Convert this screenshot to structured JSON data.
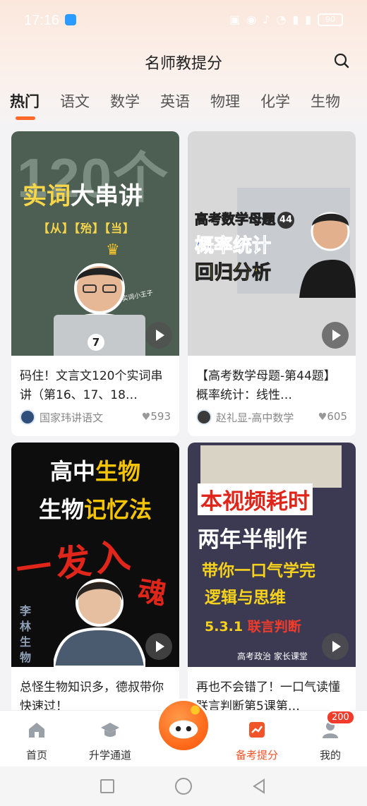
{
  "status": {
    "time": "17:16",
    "battery": "90"
  },
  "header": {
    "title": "名师教提分"
  },
  "tabs": [
    "热门",
    "语文",
    "数学",
    "英语",
    "物理",
    "化学",
    "生物"
  ],
  "cards": [
    {
      "title": "码住！文言文120个实词串讲（第16、17、18…",
      "author": "国家玮讲语文",
      "likes": "593",
      "thumb": {
        "big": "120个",
        "banner_y": "实词",
        "banner_w": "大串讲",
        "tags": "【从】【殆】【当】",
        "badge": "7",
        "sig": "实词小王子"
      }
    },
    {
      "title": "【高考数学母题-第44题】概率统计：线性…",
      "author": "赵礼显-高中数学",
      "likes": "605",
      "thumb": {
        "line1": "高考数学母题",
        "num": "44",
        "line2": "概率统计",
        "line3": "回归分析"
      }
    },
    {
      "title": "总怪生物知识多，德叔带你快速过！",
      "author": "",
      "likes": "",
      "thumb": {
        "l1a": "高中",
        "l1b": "生物",
        "l2a": "生物",
        "l2b": "记忆法",
        "brush": "一发入",
        "brush2": "魂",
        "side": "李林生物"
      }
    },
    {
      "title": "再也不会错了！一口气读懂联言判断第5课第…",
      "author": "",
      "likes": "",
      "thumb": {
        "red": "本视频耗时",
        "white": "两年半制作",
        "y1": "带你一口气学完",
        "y2": "逻辑与思维",
        "l5a": "5.3.1",
        "l5b": "联言判断",
        "foot": "高考政治    家长课堂"
      }
    }
  ],
  "nav": {
    "items": [
      "首页",
      "升学通道",
      "备考提分",
      "我的"
    ],
    "badge": "200"
  },
  "colors": {
    "accent": "#ff6a2b",
    "active_nav": "#f2542a"
  }
}
